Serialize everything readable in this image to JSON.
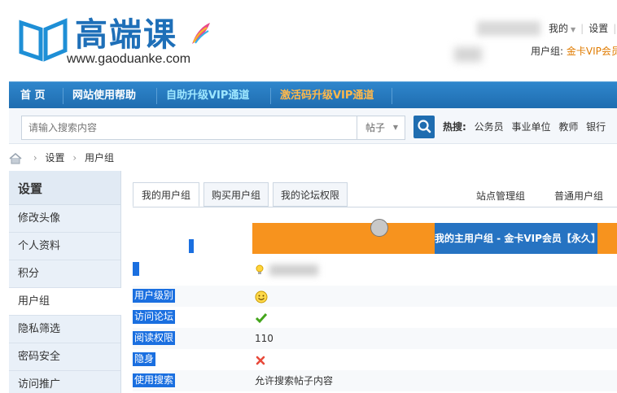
{
  "brand": {
    "name": "高端课",
    "url": "www.gaoduanke.com"
  },
  "user_menu": {
    "mine": "我的",
    "settings": "设置",
    "usergroup_label": "用户组:",
    "usergroup_value": "金卡VIP会员"
  },
  "nav": {
    "items": [
      {
        "label": "首 页"
      },
      {
        "label": "网站使用帮助"
      },
      {
        "label": "自助升级VIP通道"
      },
      {
        "label": "激活码升级VIP通道"
      }
    ]
  },
  "search": {
    "placeholder": "请输入搜索内容",
    "scope": "帖子",
    "hot_label": "热搜:",
    "hot_keywords": [
      "公务员",
      "事业单位",
      "教师",
      "银行"
    ]
  },
  "breadcrumb": {
    "items": [
      "设置",
      "用户组"
    ]
  },
  "sidebar": {
    "title": "设置",
    "items": [
      {
        "label": "修改头像"
      },
      {
        "label": "个人资料"
      },
      {
        "label": "积分"
      },
      {
        "label": "用户组"
      },
      {
        "label": "隐私筛选"
      },
      {
        "label": "密码安全"
      },
      {
        "label": "访问推广"
      }
    ]
  },
  "tabs": {
    "items": [
      {
        "label": "我的用户组"
      },
      {
        "label": "购买用户组"
      },
      {
        "label": "我的论坛权限"
      }
    ],
    "right": [
      {
        "label": "站点管理组"
      },
      {
        "label": "普通用户组"
      }
    ]
  },
  "group_header": "我的主用户组 - 金卡VIP会员【永久】",
  "rows": [
    {
      "key": "用户级别",
      "value_icon": "smiley-icon"
    },
    {
      "key": "访问论坛",
      "value_icon": "check-icon"
    },
    {
      "key": "阅读权限",
      "value": "110"
    },
    {
      "key": "隐身",
      "value_icon": "cross-icon"
    },
    {
      "key": "使用搜索",
      "value": "允许搜索帖子内容"
    }
  ],
  "colors": {
    "nav_blue": "#1f6db0",
    "orange": "#f7931e",
    "group_blue": "#2673c2",
    "highlight": "#1a6fe0",
    "vip_text": "#e07b00"
  }
}
